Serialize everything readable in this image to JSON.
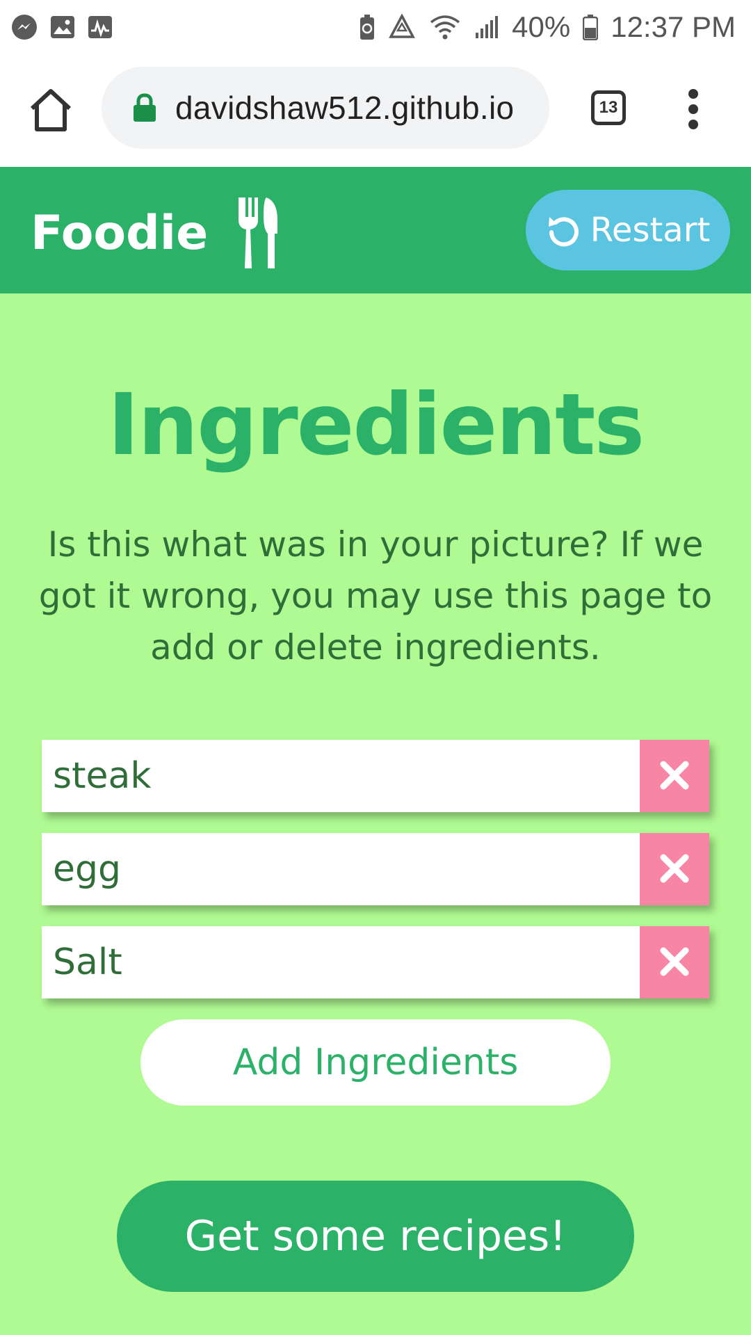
{
  "status_bar": {
    "battery_percent": "40%",
    "time": "12:37 PM",
    "left_icons": [
      "messenger-icon",
      "gallery-icon",
      "activity-icon"
    ],
    "right_icons": [
      "battery-saver-icon",
      "recycle-icon",
      "wifi-icon",
      "signal-icon",
      "battery-icon"
    ]
  },
  "browser": {
    "url": "davidshaw512.github.io",
    "tab_count": "13"
  },
  "header": {
    "brand": "Foodie",
    "restart_label": "Restart"
  },
  "main": {
    "title": "Ingredients",
    "description": "Is this what was in your picture? If we got it wrong, you may use this page to add or delete ingredients.",
    "ingredients": [
      "steak",
      "egg",
      "Salt"
    ],
    "add_label": "Add Ingredients",
    "submit_label": "Get some recipes!"
  },
  "colors": {
    "background": "#affa92",
    "brand_green": "#2bb268",
    "restart_blue": "#5bc4e0",
    "delete_pink": "#f985a5",
    "text_dark_green": "#2f6e39"
  }
}
